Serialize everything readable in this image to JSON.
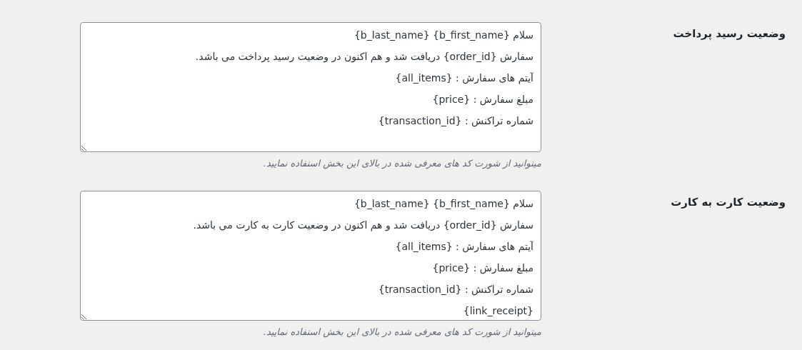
{
  "settings": [
    {
      "label": "وضعیت رسید پرداخت",
      "message_lines": [
        "سلام {b_first_name} {b_last_name}",
        "سفارش {order_id} دریافت شد و هم اکنون در وضعیت رسید پرداخت می باشد.",
        "آیتم های سفارش : {all_items}",
        "مبلغ سفارش : {price}",
        "شماره تراکنش : {transaction_id}"
      ],
      "description": "میتوانید از شورت کد های معرفی شده در بالای این بخش استفاده نمایید."
    },
    {
      "label": "وضعیت کارت به کارت",
      "message_lines": [
        "سلام {b_first_name} {b_last_name}",
        "سفارش {order_id} دریافت شد و هم اکنون در وضعیت کارت به کارت می باشد.",
        "آیتم های سفارش : {all_items}",
        "مبلغ سفارش : {price}",
        "شماره تراکنش : {transaction_id}",
        "{link_receipt}"
      ],
      "description": "میتوانید از شورت کد های معرفی شده در بالای این بخش استفاده نمایید."
    }
  ]
}
